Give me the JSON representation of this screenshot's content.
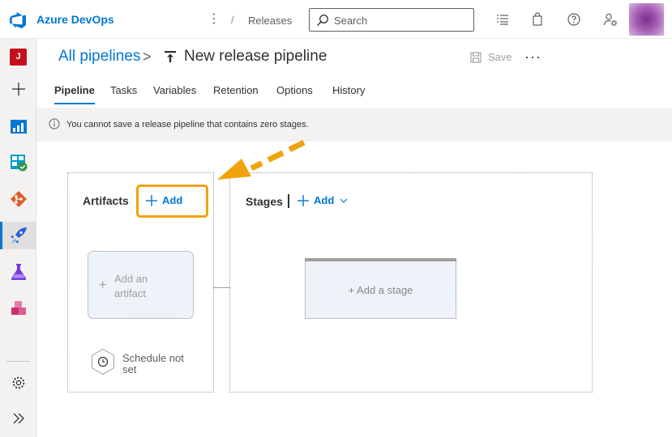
{
  "topbar": {
    "brand": "Azure DevOps",
    "breadcrumb_sep": "/",
    "breadcrumb": "Releases",
    "search_placeholder": "Search",
    "icons": [
      "azure-devops-logo-icon",
      "more-vertical-icon",
      "search-icon",
      "list-icon",
      "shopping-bag-icon",
      "help-icon",
      "user-settings-icon"
    ]
  },
  "leftnav": {
    "project_initial": "J",
    "items": [
      "project",
      "add",
      "overview",
      "boards",
      "repos",
      "pipelines",
      "test-plans",
      "artifacts",
      "project-settings",
      "expand"
    ]
  },
  "header": {
    "all_pipelines": "All pipelines",
    "chevron": ">",
    "title": "New release pipeline",
    "save_label": "Save",
    "more": "···"
  },
  "tabs": [
    {
      "label": "Pipeline",
      "active": true
    },
    {
      "label": "Tasks",
      "active": false
    },
    {
      "label": "Variables",
      "active": false
    },
    {
      "label": "Retention",
      "active": false
    },
    {
      "label": "Options",
      "active": false
    },
    {
      "label": "History",
      "active": false
    }
  ],
  "info": {
    "message": "You cannot save a release pipeline that contains zero stages."
  },
  "artifacts": {
    "title": "Artifacts",
    "add_label": "Add",
    "placeholder_label": "Add an artifact",
    "schedule_label": "Schedule not set"
  },
  "stages": {
    "title": "Stages",
    "add_label": "Add",
    "placeholder_label": "+ Add a stage"
  },
  "colors": {
    "accent": "#0078d4",
    "highlight": "#f0a30a",
    "project_badge": "#c50f1f"
  }
}
